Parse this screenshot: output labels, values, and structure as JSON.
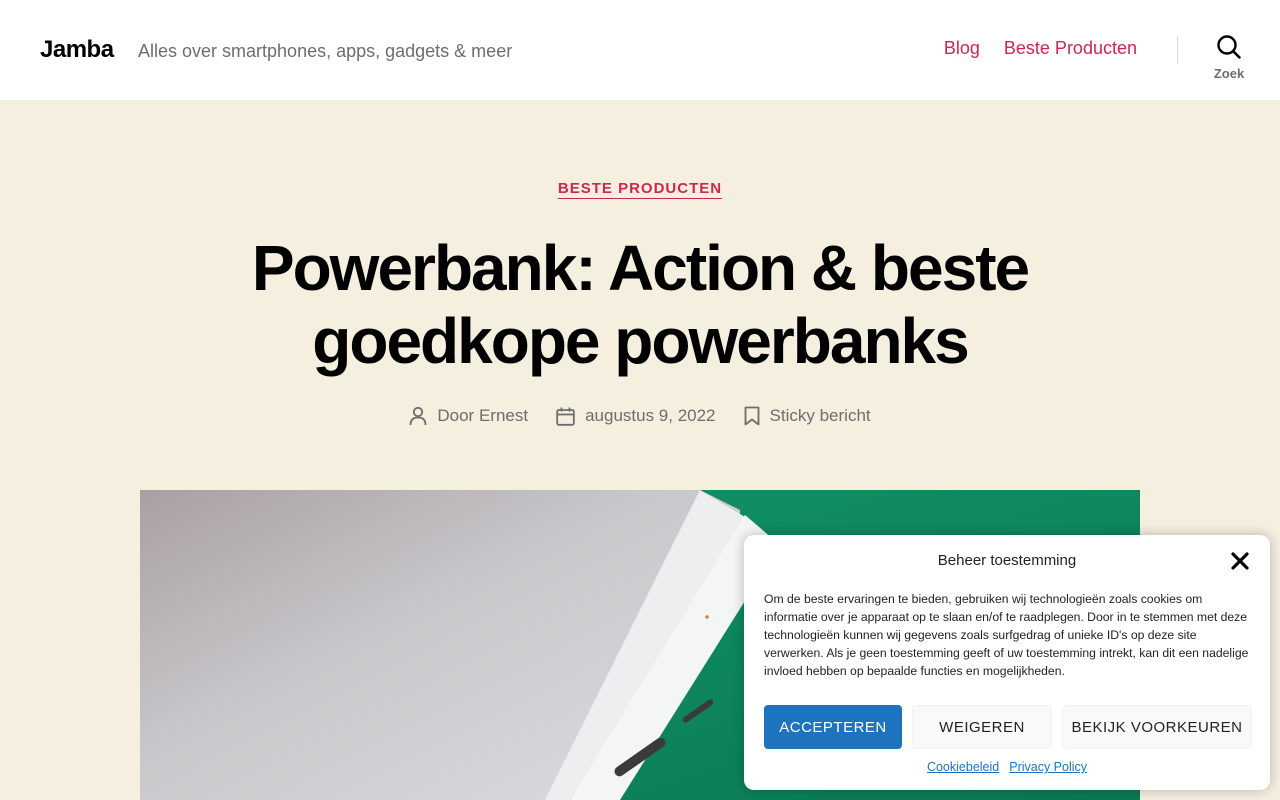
{
  "header": {
    "site_title": "Jamba",
    "tagline": "Alles over smartphones, apps, gadgets & meer",
    "nav": [
      {
        "label": "Blog"
      },
      {
        "label": "Beste Producten"
      }
    ],
    "search_label": "Zoek"
  },
  "post": {
    "category": "BESTE PRODUCTEN",
    "title": "Powerbank: Action & beste goedkope powerbanks",
    "meta": {
      "author": "Door Ernest",
      "date": "augustus 9, 2022",
      "sticky": "Sticky bericht"
    }
  },
  "consent": {
    "title": "Beheer toestemming",
    "text": "Om de beste ervaringen te bieden, gebruiken wij technologieën zoals cookies om informatie over je apparaat op te slaan en/of te raadplegen. Door in te stemmen met deze technologieën kunnen wij gegevens zoals surfgedrag of unieke ID's op deze site verwerken. Als je geen toestemming geeft of uw toestemming intrekt, kan dit een nadelige invloed hebben op bepaalde functies en mogelijkheden.",
    "buttons": {
      "accept": "ACCEPTEREN",
      "deny": "WEIGEREN",
      "preferences": "BEKIJK VOORKEUREN"
    },
    "links": {
      "cookie_policy": "Cookiebeleid",
      "privacy_policy": "Privacy Policy"
    }
  },
  "colors": {
    "accent": "#cd2653",
    "background": "#f5efe0",
    "consent_primary": "#1e73be"
  },
  "icons": [
    "search-icon",
    "user-icon",
    "calendar-icon",
    "bookmark-icon",
    "close-icon"
  ]
}
